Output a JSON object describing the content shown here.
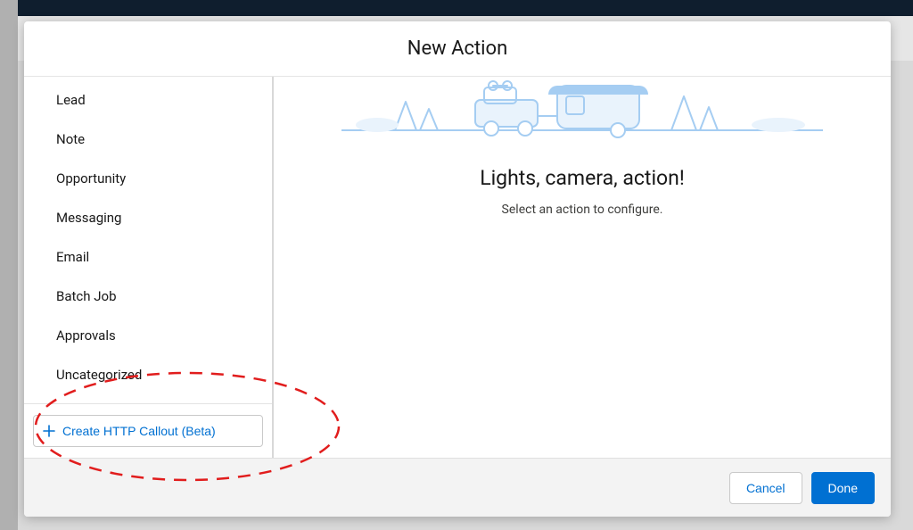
{
  "modal": {
    "title": "New Action",
    "hero_title": "Lights, camera, action!",
    "hero_sub": "Select an action to configure."
  },
  "sidebar": {
    "items": [
      {
        "label": "Lead"
      },
      {
        "label": "Note"
      },
      {
        "label": "Opportunity"
      },
      {
        "label": "Messaging"
      },
      {
        "label": "Email"
      },
      {
        "label": "Batch Job"
      },
      {
        "label": "Approvals"
      },
      {
        "label": "Uncategorized"
      }
    ],
    "create_label": "Create HTTP Callout (Beta)"
  },
  "footer": {
    "cancel_label": "Cancel",
    "done_label": "Done"
  },
  "colors": {
    "accent": "#0070d2",
    "illustration": "#a5cdf2",
    "annotation": "#e11d1d"
  }
}
